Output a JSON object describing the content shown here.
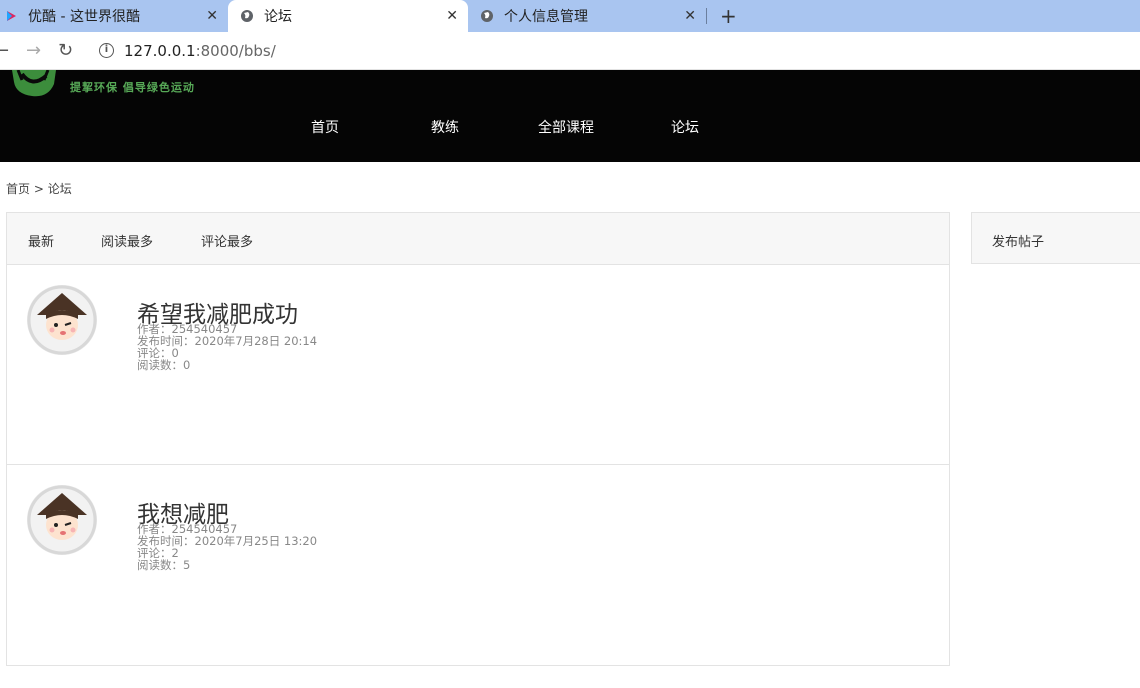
{
  "browser": {
    "tabs": [
      {
        "title": "优酷 - 这世界很酷"
      },
      {
        "title": "论坛"
      },
      {
        "title": "个人信息管理"
      }
    ],
    "new_tab": "+",
    "close_glyph": "✕",
    "url_host": "127.0.0.1",
    "url_rest": ":8000/bbs/"
  },
  "header": {
    "slogan": "提挈环保 倡导绿色运动",
    "nav": [
      "首页",
      "教练",
      "全部课程",
      "论坛"
    ]
  },
  "breadcrumb": {
    "home": "首页",
    "sep": ">",
    "current": "论坛"
  },
  "filters": [
    "最新",
    "阅读最多",
    "评论最多"
  ],
  "posts": [
    {
      "title": "希望我减肥成功",
      "author": "作者：254540457",
      "time": "发布时间：2020年7月28日 20:14",
      "comments": "评论：0",
      "reads": "阅读数：0"
    },
    {
      "title": "我想减肥",
      "author": "作者：254540457",
      "time": "发布时间：2020年7月25日 13:20",
      "comments": "评论：2",
      "reads": "阅读数：5"
    }
  ],
  "sidebar": {
    "publish": "发布帖子"
  },
  "colors": {
    "header_bg": "#050505",
    "slogan_green": "#57a957",
    "tabstrip": "#a9c5f0"
  }
}
